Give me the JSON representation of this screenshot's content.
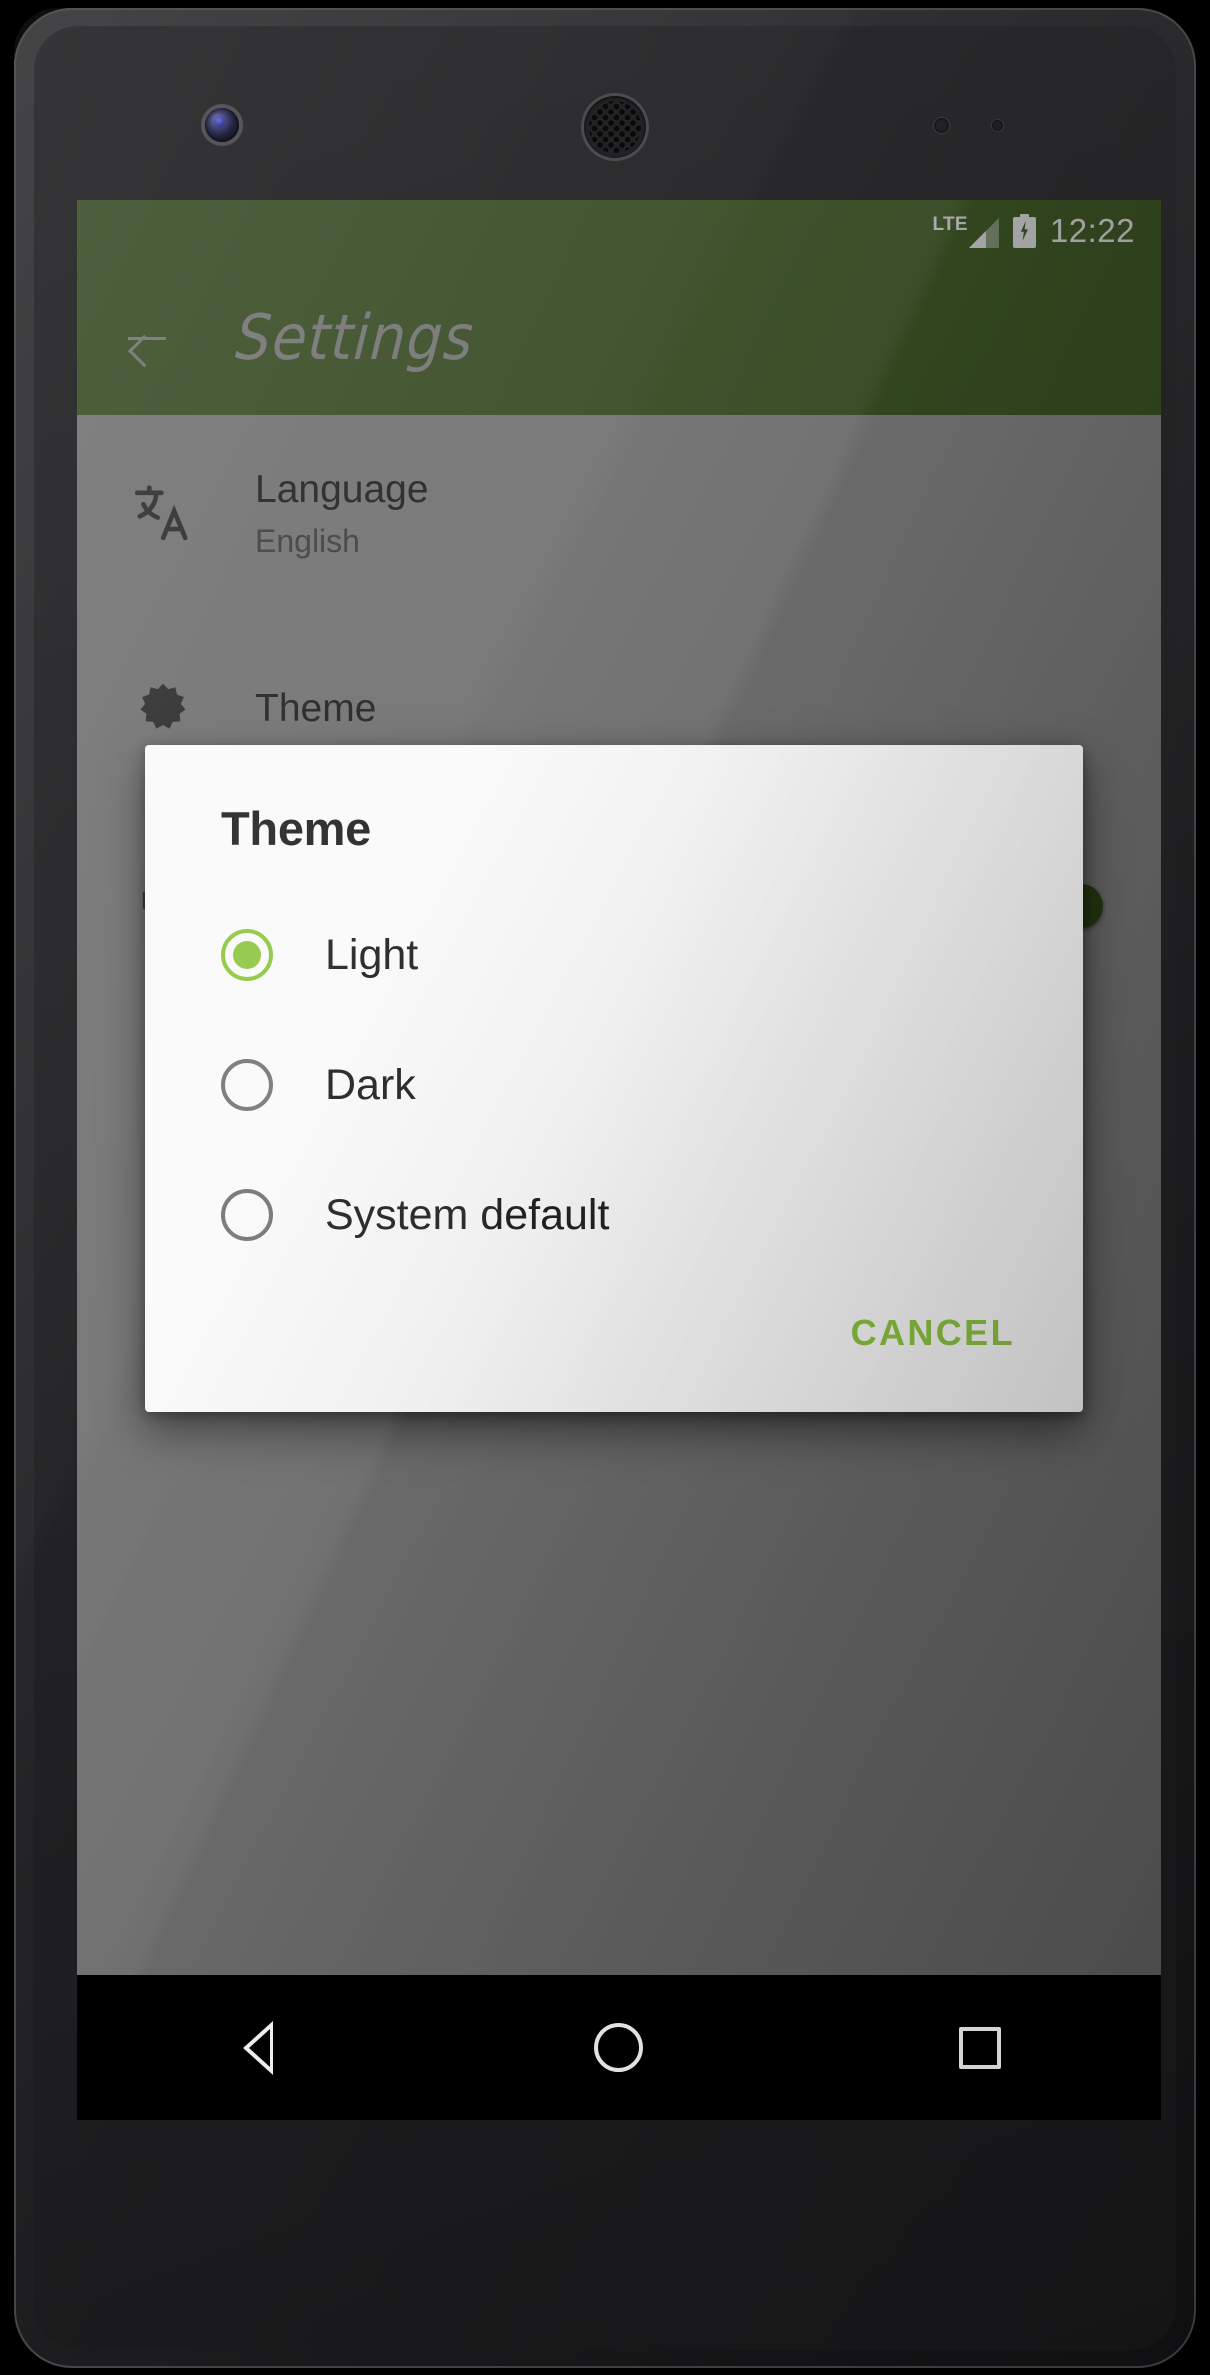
{
  "status_bar": {
    "network_label": "LTE",
    "signal_icon": "signal-bars-icon",
    "battery_icon": "battery-charging-icon",
    "time": "12:22"
  },
  "app_bar": {
    "back_icon": "back-arrow-icon",
    "title": "Settings",
    "background_color": "#4c6b2f"
  },
  "settings_list": [
    {
      "icon": "translate-icon",
      "title": "Language",
      "subtitle": "English"
    },
    {
      "icon": "theme-gear-icon",
      "title": "Theme",
      "subtitle": ""
    },
    {
      "icon": "toggle-row-icon",
      "title": "",
      "subtitle": "",
      "switch_on": true
    }
  ],
  "dialog": {
    "title": "Theme",
    "options": [
      {
        "label": "Light",
        "selected": true
      },
      {
        "label": "Dark",
        "selected": false
      },
      {
        "label": "System default",
        "selected": false
      }
    ],
    "cancel_label": "CANCEL",
    "accent_color": "#8cc63f"
  },
  "nav_bar": {
    "back_icon": "nav-back-triangle-icon",
    "home_icon": "nav-home-circle-icon",
    "recents_icon": "nav-recents-square-icon"
  }
}
